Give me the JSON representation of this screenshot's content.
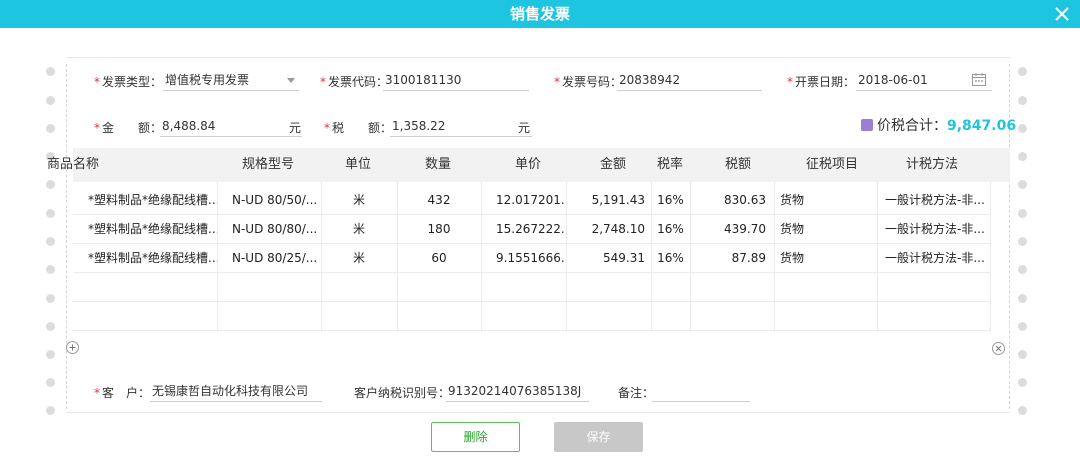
{
  "window": {
    "title": "销售发票"
  },
  "colors": {
    "accent": "#1ec5e0",
    "required": "#e0333a",
    "delete_border": "#5cc25c",
    "disabled": "#c8c8c8"
  },
  "header": {
    "invoice_type": {
      "label": "发票类型：",
      "value": "增值税专用发票"
    },
    "invoice_code": {
      "label": "发票代码：",
      "value": "3100181130"
    },
    "invoice_number": {
      "label": "发票号码：",
      "value": "20838942"
    },
    "issue_date": {
      "label": "开票日期：",
      "value": "2018-06-01"
    },
    "amount": {
      "label": "金　　额：",
      "value": "8,488.84",
      "unit": "元"
    },
    "tax": {
      "label": "税　　额：",
      "value": "1,358.22",
      "unit": "元"
    },
    "total": {
      "label": "价税合计：",
      "value": "9,847.06"
    }
  },
  "table": {
    "columns": [
      "商品名称",
      "规格型号",
      "单位",
      "数量",
      "单价",
      "金额",
      "税率",
      "税额",
      "征税项目",
      "计税方法"
    ],
    "rows": [
      [
        "*塑料制品*绝缘配线槽...",
        "N-UD 80/50/...",
        "米",
        "432",
        "12.017201...",
        "5,191.43",
        "16%",
        "830.63",
        "货物",
        "一般计税方法-非..."
      ],
      [
        "*塑料制品*绝缘配线槽...",
        "N-UD 80/80/...",
        "米",
        "180",
        "15.267222...",
        "2,748.10",
        "16%",
        "439.70",
        "货物",
        "一般计税方法-非..."
      ],
      [
        "*塑料制品*绝缘配线槽...",
        "N-UD 80/25/...",
        "米",
        "60",
        "9.1551666...",
        "549.31",
        "16%",
        "87.89",
        "货物",
        "一般计税方法-非..."
      ]
    ]
  },
  "footer": {
    "customer": {
      "label": "客　户：",
      "value": "无锡康哲自动化科技有限公司"
    },
    "tax_id": {
      "label": "客户纳税识别号：",
      "value": "91320214076385138J"
    },
    "note": {
      "label": "备注：",
      "value": ""
    }
  },
  "actions": {
    "delete_label": "删除",
    "save_label": "保存"
  },
  "icons": {
    "close": "close-icon",
    "calendar": "calendar-icon",
    "add_row": "plus-circle-icon",
    "remove_row": "x-circle-icon"
  }
}
